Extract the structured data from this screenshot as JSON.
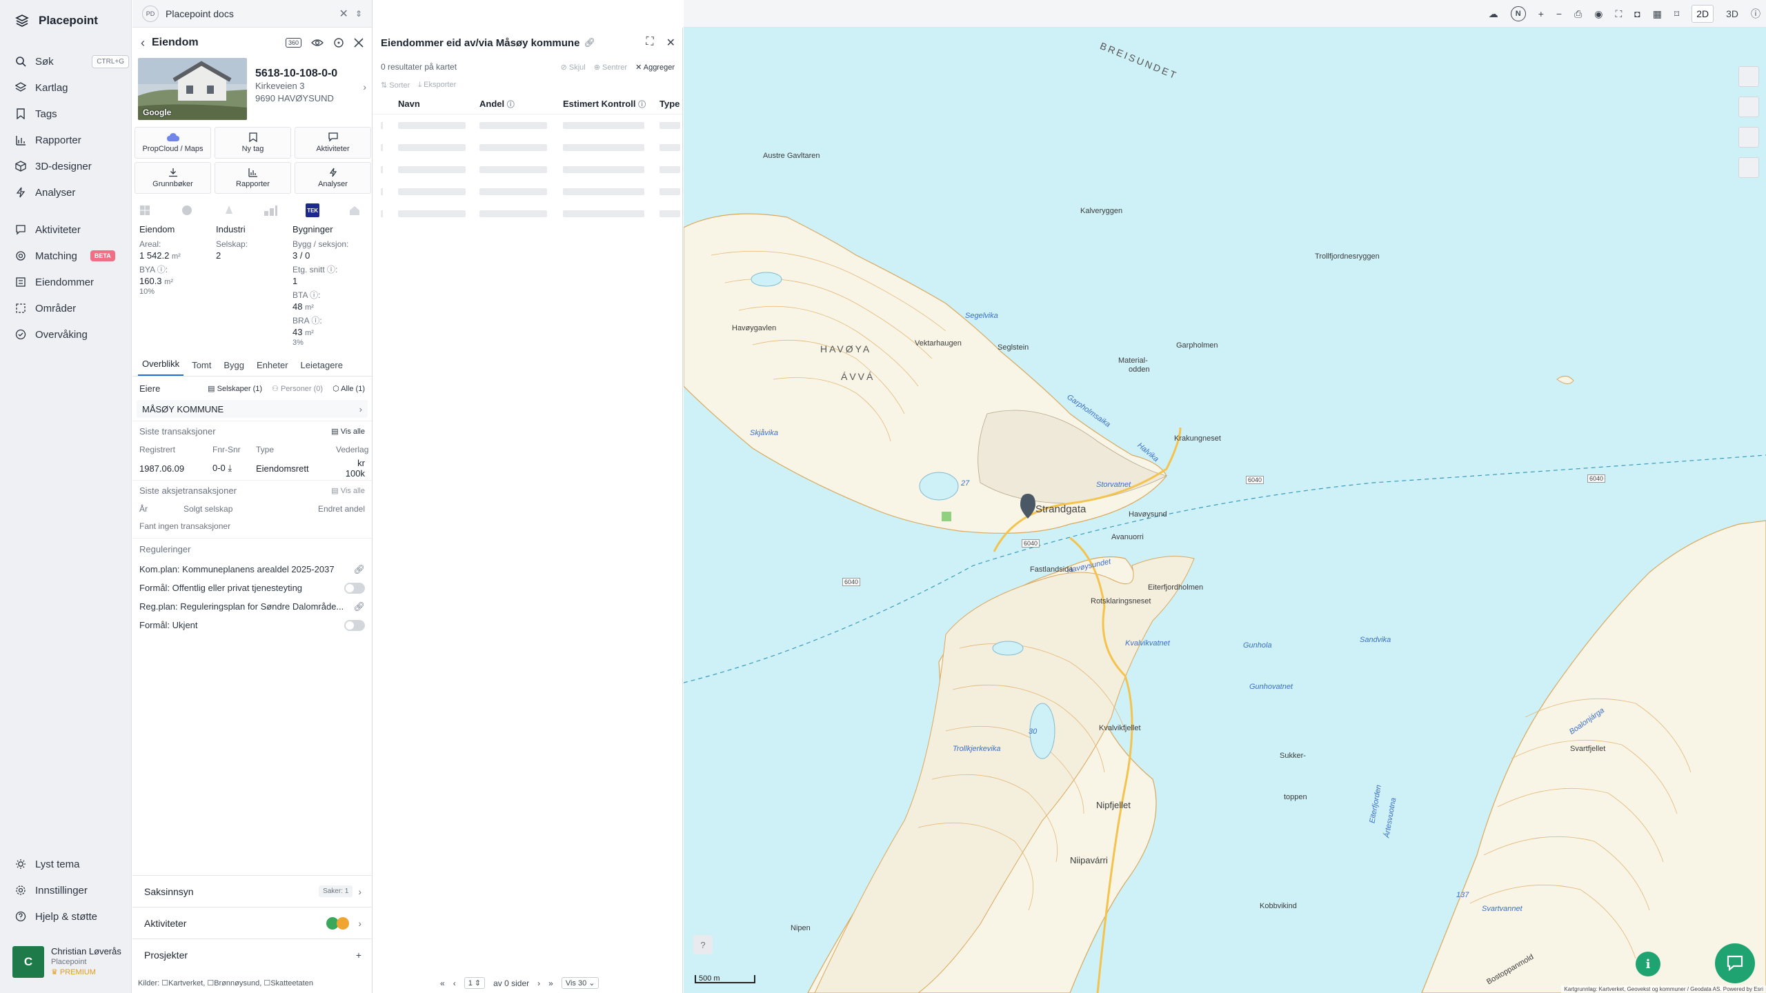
{
  "nav": {
    "brand": "Placepoint",
    "items": [
      {
        "label": "Søk",
        "kbd": "CTRL+G"
      },
      {
        "label": "Kartlag"
      },
      {
        "label": "Tags"
      },
      {
        "label": "Rapporter"
      },
      {
        "label": "3D-designer"
      },
      {
        "label": "Analyser"
      },
      {
        "label": "Aktiviteter"
      },
      {
        "label": "Matching",
        "badge": "BETA"
      },
      {
        "label": "Eiendommer"
      },
      {
        "label": "Områder"
      },
      {
        "label": "Overvåking"
      }
    ],
    "bottom": [
      {
        "label": "Lyst tema"
      },
      {
        "label": "Innstillinger"
      },
      {
        "label": "Hjelp & støtte"
      }
    ],
    "user": {
      "initial": "C",
      "name": "Christian Løverås",
      "org": "Placepoint",
      "plan": "PREMIUM"
    }
  },
  "doc_tab": {
    "badge": "PD",
    "title": "Placepoint docs"
  },
  "property": {
    "header": "Eiendom",
    "tag_360": "360",
    "photo_label": "Google",
    "id": "5618-10-108-0-0",
    "street": "Kirkeveien 3",
    "postal": "9690 HAVØYSUND",
    "actions": [
      "PropCloud / Maps",
      "Ny tag",
      "Aktiviteter",
      "Grunnbøker",
      "Rapporter",
      "Analyser"
    ],
    "tek": "TEK",
    "facts": {
      "col1_head": "Eiendom",
      "areal_label": "Areal:",
      "areal_value": "1 542.2",
      "areal_unit": "m²",
      "bya_label": "BYA ⓘ:",
      "bya_value": "160.3",
      "bya_unit": "m²",
      "bya_pct": "10%",
      "col2_head": "Industri",
      "selskap_label": "Selskap:",
      "selskap_value": "2",
      "col3_head": "Bygninger",
      "bygg_label": "Bygg / seksjon:",
      "bygg_value": "3 / 0",
      "etg_label": "Etg. snitt ⓘ:",
      "etg_value": "1",
      "bta_label": "BTA ⓘ:",
      "bta_value": "48",
      "bta_unit": "m²",
      "bra_label": "BRA ⓘ:",
      "bra_value": "43",
      "bra_unit": "m²",
      "bra_pct": "3%"
    },
    "tabs": [
      "Overblikk",
      "Tomt",
      "Bygg",
      "Enheter",
      "Leietagere"
    ],
    "owners": {
      "label": "Eiere",
      "f_companies": "Selskaper (1)",
      "f_persons": "Personer (0)",
      "f_all": "Alle (1)",
      "owner": "MÅSØY KOMMUNE"
    },
    "transactions": {
      "label": "Siste transaksjoner",
      "show_all": "Vis alle",
      "headers": [
        "Registrert",
        "Fnr-Snr",
        "Type",
        "Vederlag"
      ],
      "row": [
        "1987.06.09",
        "0-0",
        "Eiendomsrett",
        "kr 100k"
      ]
    },
    "share_tx": {
      "label": "Siste aksjetransaksjoner",
      "show_all": "Vis alle",
      "headers": [
        "År",
        "Solgt selskap",
        "Endret andel"
      ],
      "empty": "Fant ingen transaksjoner"
    },
    "regulations": {
      "label": "Reguleringer",
      "items": [
        {
          "text": "Kom.plan: Kommuneplanens arealdel 2025-2037",
          "kind": "link"
        },
        {
          "text": "Formål: Offentlig eller privat tjenesteyting",
          "kind": "toggle"
        },
        {
          "text": "Reg.plan: Reguleringsplan for Søndre Dalområde...",
          "kind": "link"
        },
        {
          "text": "Formål: Ukjent",
          "kind": "toggle"
        }
      ]
    },
    "accordions": [
      {
        "label": "Saksinnsyn",
        "pill": "Saker: 1"
      },
      {
        "label": "Aktiviteter"
      },
      {
        "label": "Prosjekter"
      }
    ],
    "sources": "Kilder: ☐Kartverket, ☐Brønnøysund, ☐Skatteetaten"
  },
  "results": {
    "title": "Eiendommer eid av/via Måsøy kommune",
    "count": "0 resultater på kartet",
    "actions": [
      "Skjul",
      "Sentrer",
      "Aggreger"
    ],
    "tools": [
      "Sorter",
      "Eksporter"
    ],
    "columns": [
      "Navn",
      "Andel",
      "Estimert Kontroll",
      "Type"
    ],
    "pager": {
      "page": "1",
      "of": "av 0 sider",
      "per_page": "Vis 30"
    }
  },
  "map": {
    "mode_2d": "2D",
    "mode_3d": "3D",
    "north": "N",
    "labels": [
      "BREISUNDET",
      "Austre Gavltaren",
      "Kalveryggen",
      "Trollfjordnesryggen",
      "Havøygavlen",
      "HAVØYA",
      "ÁVVÁ",
      "Vektarhaugen",
      "Segelvika",
      "Seglstein",
      "Garpholmen",
      "Garpholmsaika",
      "Material-",
      "odden",
      "Krakungneset",
      "Skjåvika",
      "Storvatnet",
      "Halvika",
      "Havøysund",
      "Avanuorri",
      "Strandgata",
      "Havøysundet",
      "Fastlandsida",
      "Eiterfjordholmen",
      "Rotsklaringsneset",
      "Kvalvikvatnet",
      "Gunhola",
      "Sandvika",
      "Gunhovatnet",
      "Kvalvikfjellet",
      "Trollkjerkevika",
      "Svartfjellet",
      "Boalonjárga",
      "Sukker-",
      "toppen",
      "Nipfjellet",
      "Niipavárri",
      "Kobbvikind",
      "Svartvannet",
      "Nipen",
      "Ártesvuotna",
      "Eiterfjorden",
      "Bostoppanmold",
      "30",
      "27",
      "137",
      "6040",
      "6040",
      "6040",
      "6040"
    ],
    "scale": "500 m",
    "attribution": "Kartgrunnlag: Kartverket, Geovekst og kommuner / Geodata AS. Powered by Esri"
  }
}
